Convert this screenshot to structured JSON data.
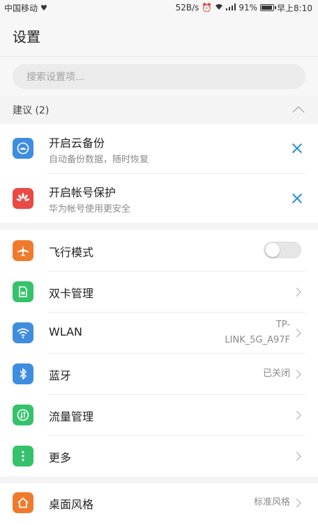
{
  "status_bar": {
    "carrier": "中国移动",
    "speed": "52B/s",
    "battery": "91%",
    "time": "早上8:10"
  },
  "header": {
    "title": "设置"
  },
  "search": {
    "placeholder": "搜索设置项..."
  },
  "suggestions": {
    "label": "建议 (2)",
    "items": [
      {
        "title": "开启云备份",
        "subtitle": "自动备份数据，随时恢复",
        "icon": "cloud-backup-icon",
        "color": "#3f8ddf"
      },
      {
        "title": "开启帐号保护",
        "subtitle": "华为帐号使用更安全",
        "icon": "huawei-icon",
        "color": "#e94a46"
      }
    ]
  },
  "network": {
    "items": [
      {
        "title": "飞行模式",
        "icon": "airplane-icon",
        "color": "#f07a2b",
        "toggle": false
      },
      {
        "title": "双卡管理",
        "icon": "sim-card-icon",
        "color": "#35c26b"
      },
      {
        "title": "WLAN",
        "icon": "wifi-icon",
        "color": "#3f8ddf",
        "value_line1": "TP-",
        "value_line2": "LINK_5G_A97F"
      },
      {
        "title": "蓝牙",
        "icon": "bluetooth-icon",
        "color": "#3f8ddf",
        "value": "已关闭"
      },
      {
        "title": "流量管理",
        "icon": "data-usage-icon",
        "color": "#35c26b"
      },
      {
        "title": "更多",
        "icon": "more-icon",
        "color": "#35c26b"
      }
    ]
  },
  "display": {
    "items": [
      {
        "title": "桌面风格",
        "icon": "home-icon",
        "color": "#f07a2b",
        "value": "标准风格"
      }
    ]
  }
}
